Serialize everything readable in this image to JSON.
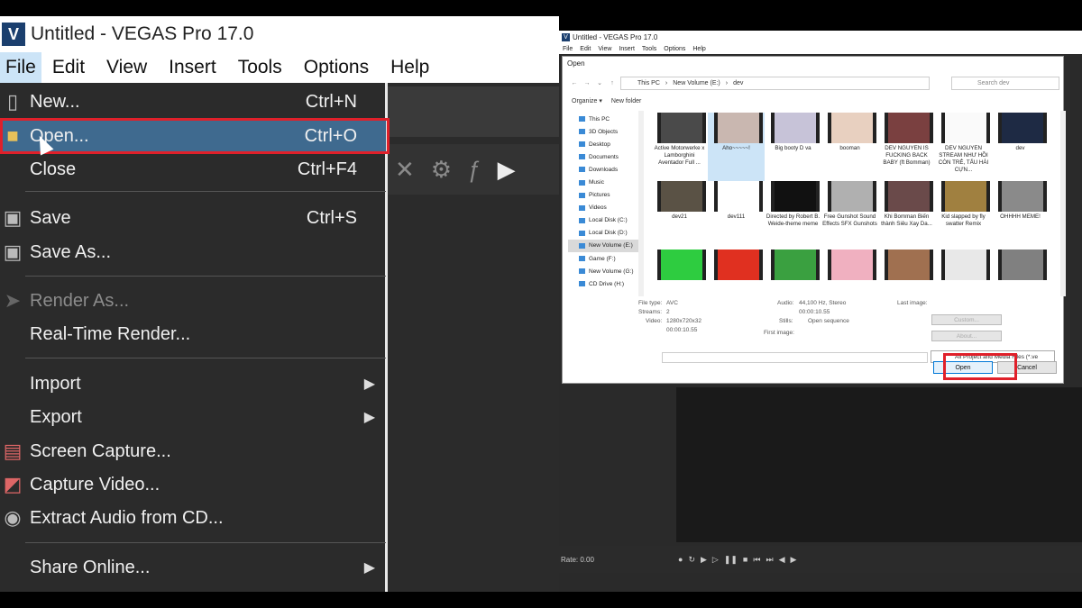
{
  "left": {
    "app_title": "Untitled - VEGAS Pro 17.0",
    "logo_text": "V",
    "menu": [
      "File",
      "Edit",
      "View",
      "Insert",
      "Tools",
      "Options",
      "Help"
    ],
    "file_menu": [
      {
        "label": "New...",
        "shortcut": "Ctrl+N",
        "icon": "new-file-icon",
        "disabled": false
      },
      {
        "label": "Open...",
        "shortcut": "Ctrl+O",
        "icon": "folder-icon",
        "disabled": false,
        "highlighted": true
      },
      {
        "label": "Close",
        "shortcut": "Ctrl+F4",
        "icon": "",
        "disabled": false
      },
      {
        "label": "Save",
        "shortcut": "Ctrl+S",
        "icon": "save-icon",
        "disabled": false
      },
      {
        "label": "Save As...",
        "shortcut": "",
        "icon": "save-as-icon",
        "disabled": false
      },
      {
        "label": "Render As...",
        "shortcut": "",
        "icon": "render-icon",
        "disabled": true
      },
      {
        "label": "Real-Time Render...",
        "shortcut": "",
        "icon": "",
        "disabled": false
      },
      {
        "label": "Import",
        "shortcut": "",
        "icon": "",
        "submenu": true,
        "disabled": false
      },
      {
        "label": "Export",
        "shortcut": "",
        "icon": "",
        "submenu": true,
        "disabled": false
      },
      {
        "label": "Screen Capture...",
        "shortcut": "",
        "icon": "screen-capture-icon",
        "disabled": false
      },
      {
        "label": "Capture Video...",
        "shortcut": "",
        "icon": "capture-video-icon",
        "disabled": false
      },
      {
        "label": "Extract Audio from CD...",
        "shortcut": "",
        "icon": "cd-icon",
        "disabled": false
      },
      {
        "label": "Share Online...",
        "shortcut": "",
        "icon": "",
        "submenu": true,
        "disabled": false
      }
    ],
    "highlight_color": "#e0202a"
  },
  "right": {
    "app_title": "Untitled - VEGAS Pro 17.0",
    "menu": [
      "File",
      "Edit",
      "View",
      "Insert",
      "Tools",
      "Options",
      "Help"
    ],
    "dialog_title": "Open",
    "breadcrumb": [
      "This PC",
      "New Volume (E:)",
      "dev"
    ],
    "search_placeholder": "Search dev",
    "organize_label": "Organize ▾",
    "new_folder_label": "New folder",
    "nav_items": [
      "This PC",
      "3D Objects",
      "Desktop",
      "Documents",
      "Downloads",
      "Music",
      "Pictures",
      "Videos",
      "Local Disk (C:)",
      "Local Disk (D:)",
      "New Volume (E:)",
      "Game (F:)",
      "New Volume (G:)",
      "CD Drive (H:)"
    ],
    "selected_nav": "New Volume (E:)",
    "files": [
      {
        "name": "Active Motorwerke x Lamborghini Aventador Full ...",
        "color": "#4a4a4a"
      },
      {
        "name": "Aho~~~~~!",
        "color": "#c9b7b0"
      },
      {
        "name": "Big booty D va",
        "color": "#c7c3d8"
      },
      {
        "name": "booman",
        "color": "#e8d0c0"
      },
      {
        "name": "DEV NGUYEN IS FUCKING BACK BABY (ft Bomman)",
        "color": "#7a4040"
      },
      {
        "name": "DEV NGUYEN STREAM NHƯ HỒI CÒN TRẺ, TẤU HÀI CỰN...",
        "color": "#fafafa"
      },
      {
        "name": "dev",
        "color": "#1e2a44"
      },
      {
        "name": "dev21",
        "color": "#5a5245"
      },
      {
        "name": "dev111",
        "color": "#ffffff"
      },
      {
        "name": "Directed by Robert B. Weide-theme meme",
        "color": "#111111"
      },
      {
        "name": "Free Gunshot Sound Effects SFX Gunshots",
        "color": "#b0b0b0"
      },
      {
        "name": "Khi Bomman Biến thành Siêu Xay Da...",
        "color": "#6a4a4a"
      },
      {
        "name": "Kid slapped by fly swatter Remix",
        "color": "#a08040"
      },
      {
        "name": "OHHHH MEME!",
        "color": "#8a8a8a"
      },
      {
        "name": "",
        "color": "#2ecc40"
      },
      {
        "name": "",
        "color": "#e03020"
      },
      {
        "name": "",
        "color": "#3aa040"
      },
      {
        "name": "",
        "color": "#f0b0c0"
      },
      {
        "name": "",
        "color": "#a07050"
      },
      {
        "name": "",
        "color": "#e8e8e8"
      },
      {
        "name": "",
        "color": "#808080"
      }
    ],
    "details": {
      "file_type_label": "File type:",
      "file_type": "AVC",
      "streams_label": "Streams:",
      "streams": "2",
      "video_label": "Video:",
      "video": "1280x720x32",
      "video_len": "00:00:10.55",
      "audio_label": "Audio:",
      "audio": "44,100 Hz, Stereo",
      "audio_len": "00:00:10.55",
      "stills_label": "Stills:",
      "stills": "Open sequence",
      "last_image_label": "Last image:",
      "first_image_label": "First image:"
    },
    "custom_label": "Custom...",
    "about_label": "About...",
    "file_type_filter": "All Project and Media Files (*.ve",
    "open_label": "Open",
    "cancel_label": "Cancel",
    "rate_label": "Rate: 0.00"
  }
}
